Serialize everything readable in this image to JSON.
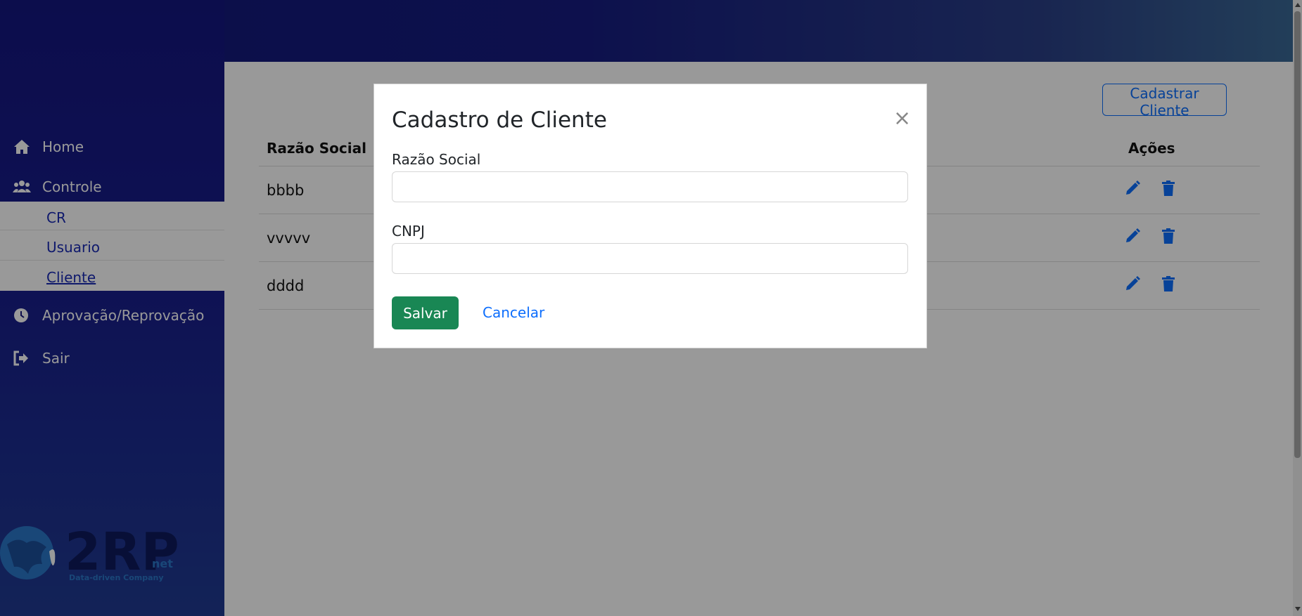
{
  "sidebar": {
    "items": [
      {
        "label": "Home",
        "icon": "home-icon"
      },
      {
        "label": "Controle",
        "icon": "users-icon"
      },
      {
        "label": "Aprovação/Reprovação",
        "icon": "clock-icon"
      },
      {
        "label": "Sair",
        "icon": "sign-out-icon"
      }
    ],
    "submenu": [
      {
        "label": "CR"
      },
      {
        "label": "Usuario"
      },
      {
        "label": "Cliente"
      }
    ],
    "logo": {
      "text": "2RP",
      "suffix": "net",
      "tagline": "Data-driven Company"
    }
  },
  "main": {
    "add_button_label": "Cadastrar Cliente",
    "table": {
      "columns": [
        "Razão Social",
        "Ações"
      ],
      "rows": [
        {
          "razao_social": "bbbb"
        },
        {
          "razao_social": "vvvvv"
        },
        {
          "razao_social": "dddd"
        }
      ]
    }
  },
  "modal": {
    "title": "Cadastro de Cliente",
    "close_label": "×",
    "fields": [
      {
        "label": "Razão Social",
        "value": "",
        "placeholder": ""
      },
      {
        "label": "CNPJ",
        "value": "",
        "placeholder": ""
      }
    ],
    "save_label": "Salvar",
    "cancel_label": "Cancelar"
  },
  "colors": {
    "primary": "#0d6efd",
    "success": "#198754",
    "sidebar": "#15167f",
    "submenu_link": "#1a2ab5"
  }
}
